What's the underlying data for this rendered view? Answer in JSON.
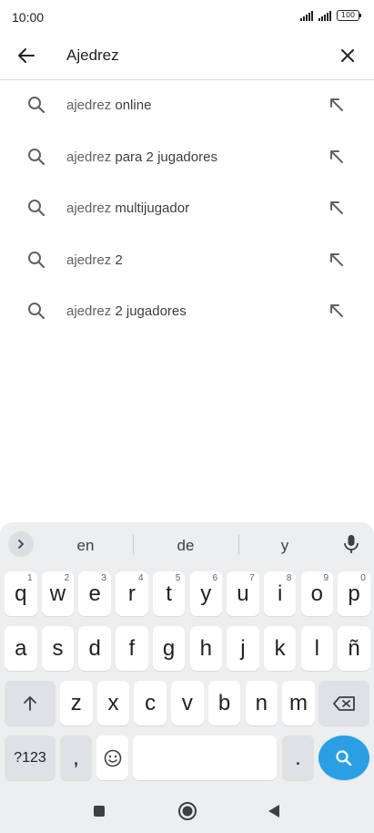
{
  "status": {
    "time": "10:00",
    "battery": "100",
    "icons": [
      "signal-icon",
      "signal-icon",
      "battery-icon"
    ]
  },
  "search": {
    "query": "Ajedrez",
    "back_icon": "arrow-left-icon",
    "clear_icon": "close-icon"
  },
  "suggestions": [
    {
      "prefix": "ajedrez",
      "rest": " online"
    },
    {
      "prefix": "ajedrez",
      "rest": " para 2 jugadores"
    },
    {
      "prefix": "ajedrez",
      "rest": " multijugador"
    },
    {
      "prefix": "ajedrez",
      "rest": " 2"
    },
    {
      "prefix": "ajedrez",
      "rest": " 2 jugadores"
    }
  ],
  "keyboard": {
    "word_suggestions": [
      "en",
      "de",
      "y"
    ],
    "row1": [
      {
        "k": "q",
        "h": "1"
      },
      {
        "k": "w",
        "h": "2"
      },
      {
        "k": "e",
        "h": "3"
      },
      {
        "k": "r",
        "h": "4"
      },
      {
        "k": "t",
        "h": "5"
      },
      {
        "k": "y",
        "h": "6"
      },
      {
        "k": "u",
        "h": "7"
      },
      {
        "k": "i",
        "h": "8"
      },
      {
        "k": "o",
        "h": "9"
      },
      {
        "k": "p",
        "h": "0"
      }
    ],
    "row2": [
      "a",
      "s",
      "d",
      "f",
      "g",
      "h",
      "j",
      "k",
      "l",
      "ñ"
    ],
    "row3": [
      "z",
      "x",
      "c",
      "v",
      "b",
      "n",
      "m"
    ],
    "symbols_label": "?123",
    "comma": ",",
    "period": "."
  },
  "colors": {
    "accent": "#2a9fe4",
    "keyboard_bg": "#eceef0",
    "divider": "#dadce0"
  }
}
